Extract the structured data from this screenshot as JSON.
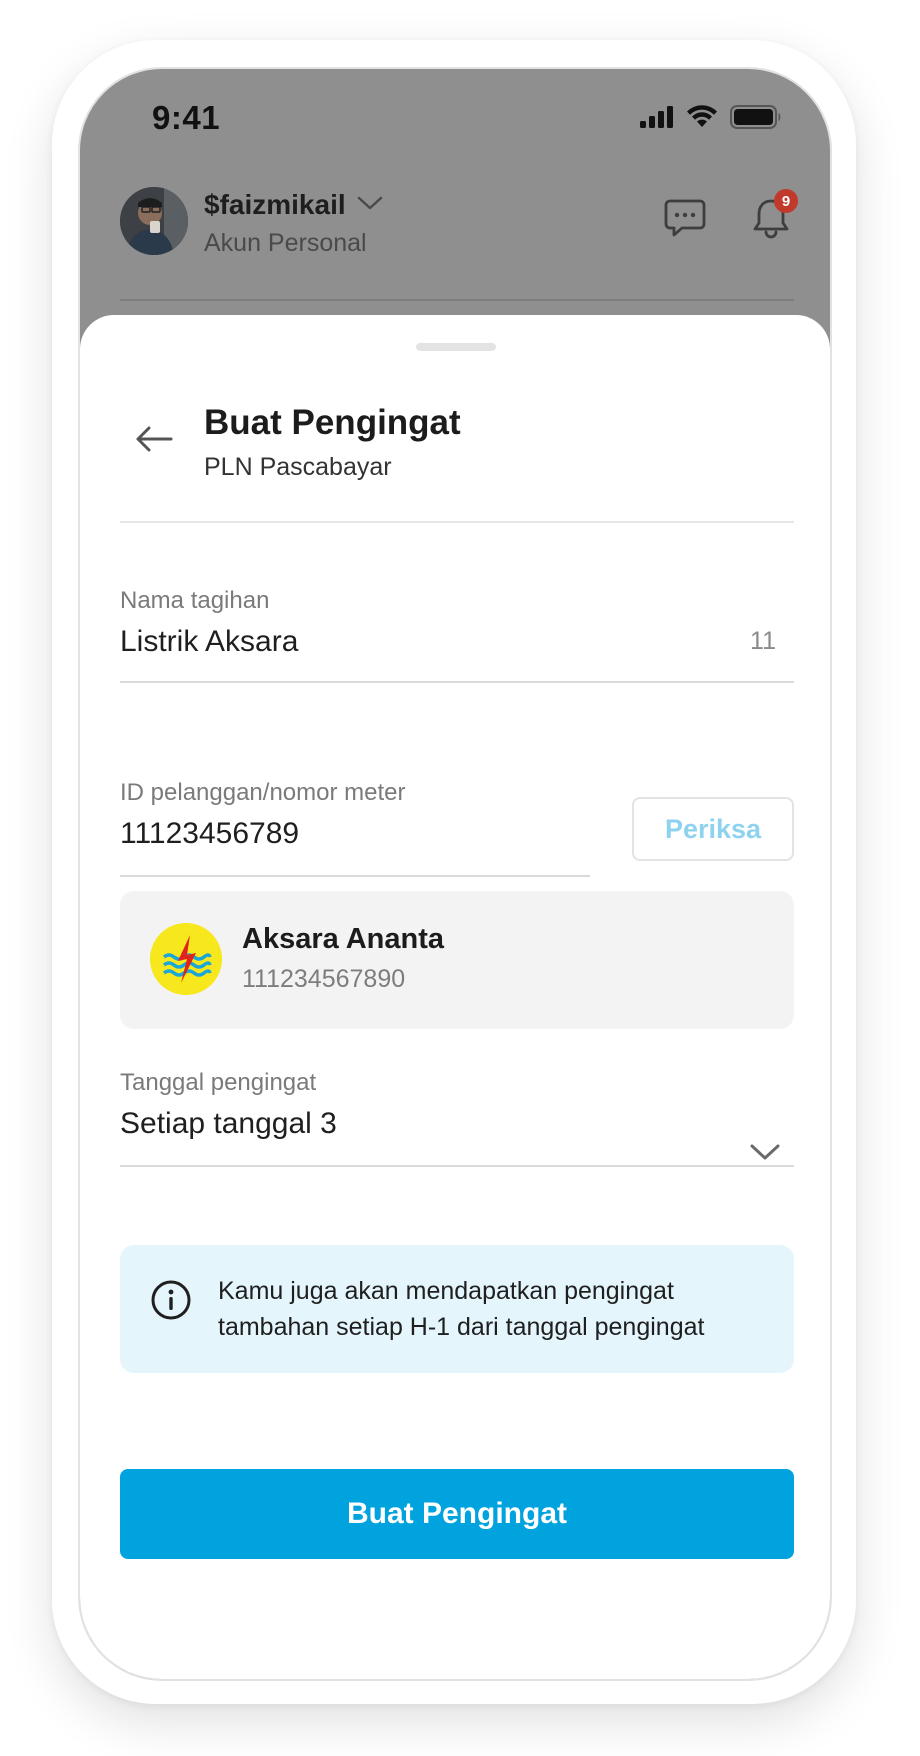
{
  "status_bar": {
    "time": "9:41",
    "icons": [
      "cellular-signal-icon",
      "wifi-icon",
      "battery-icon"
    ]
  },
  "header": {
    "username": "$faizmikail",
    "account_type": "Akun Personal",
    "notification_count": "9",
    "icons": [
      "chevron-down-icon",
      "chat-icon",
      "bell-icon"
    ]
  },
  "sheet": {
    "title": "Buat Pengingat",
    "subtitle": "PLN Pascabayar",
    "bill_name": {
      "label": "Nama tagihan",
      "value": "Listrik Aksara",
      "char_count": "11"
    },
    "customer_id": {
      "label": "ID pelanggan/nomor meter",
      "value": "11123456789",
      "check_label": "Periksa"
    },
    "customer": {
      "name": "Aksara Ananta",
      "id": "111234567890"
    },
    "reminder_date": {
      "label": "Tanggal pengingat",
      "value": "Setiap tanggal 3"
    },
    "info": {
      "line1": "Kamu juga akan mendapatkan pengingat",
      "line2": "tambahan setiap H-1 dari tanggal pengingat"
    },
    "submit_label": "Buat Pengingat"
  },
  "colors": {
    "primary": "#00a3de",
    "check_text": "#8fd2ef",
    "info_bg": "#e4f5fc",
    "badge": "#c0392b",
    "overlay": "#8f8f8f"
  }
}
